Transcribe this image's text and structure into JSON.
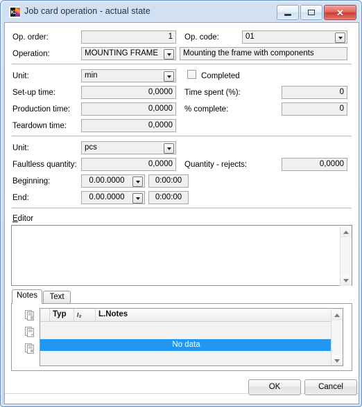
{
  "window": {
    "title": "Job card operation - actual state",
    "icon": "app-logo-icon",
    "controls": {
      "minimize": "minimize-icon",
      "maximize": "maximize-icon",
      "close": "✕"
    }
  },
  "form": {
    "op_order": {
      "label": "Op. order:",
      "value": "1"
    },
    "op_code": {
      "label": "Op. code:",
      "value": "01"
    },
    "operation": {
      "label": "Operation:",
      "value": "MOUNTING FRAME"
    },
    "operation_desc": {
      "value": "Mounting the frame with components"
    },
    "unit_time": {
      "label": "Unit:",
      "value": "min"
    },
    "completed": {
      "label": "Completed",
      "checked": false
    },
    "setup_time": {
      "label": "Set-up time:",
      "value": "0,0000"
    },
    "time_spent": {
      "label": "Time spent (%):",
      "value": "0"
    },
    "production_time": {
      "label": "Production time:",
      "value": "0,0000"
    },
    "percent_complete": {
      "label": "% complete:",
      "value": "0"
    },
    "teardown_time": {
      "label": "Teardown time:",
      "value": "0,0000"
    },
    "unit_qty": {
      "label": "Unit:",
      "value": "pcs"
    },
    "faultless_quantity": {
      "label": "Faultless quantity:",
      "value": "0,0000"
    },
    "quantity_rejects": {
      "label": "Quantity - rejects:",
      "value": "0,0000"
    },
    "beginning": {
      "label": "Beginning:",
      "date": "0.00.0000",
      "time": "0:00:00"
    },
    "end": {
      "label": "End:",
      "date": "0.00.0000",
      "time": "0:00:00"
    }
  },
  "editor": {
    "label": "Editor",
    "label_accel": "E",
    "label_rest": "ditor",
    "value": ""
  },
  "tabs": [
    {
      "label": "Notes",
      "active": true
    },
    {
      "label": "Text",
      "active": false
    }
  ],
  "notes_grid": {
    "gutter_icons": [
      "new-note-icon",
      "edit-note-icon",
      "copy-note-icon"
    ],
    "columns": [
      "Typ",
      "/₂",
      "L.Notes"
    ],
    "empty_text": "No data",
    "highlight_color": "#2196f3"
  },
  "footer": {
    "ok": "OK",
    "cancel": "Cancel"
  }
}
